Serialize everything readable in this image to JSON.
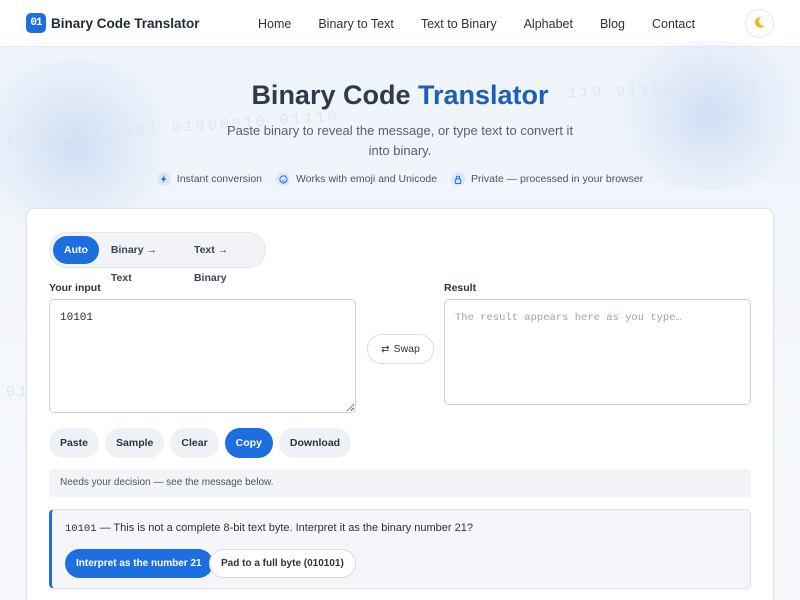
{
  "nav": {
    "logo_mark": "01",
    "logo_text": "Binary Code Translator",
    "links": [
      "Home",
      "Binary to Text",
      "Text to Binary",
      "Alphabet",
      "Blog",
      "Contact"
    ],
    "theme_icon": "moon-icon"
  },
  "hero": {
    "title_part1": "Binary Code",
    "title_part2": "Translator",
    "subtitle": "Paste binary to reveal the message, or type text to convert it into binary.",
    "badges": [
      {
        "icon": "lightning-icon",
        "label": "Instant conversion"
      },
      {
        "icon": "smile-icon",
        "label": "Works with emoji and Unicode"
      },
      {
        "icon": "lock-icon",
        "label": "Private — processed in your browser"
      }
    ],
    "decor_binary": [
      "1000 01101001 01000010 01110",
      "110 01100001 011",
      "01"
    ]
  },
  "translator": {
    "modes": [
      "Auto",
      "Binary → Text",
      "Text → Binary"
    ],
    "active_mode": "Auto",
    "input_label": "Your input",
    "input_value": "10101",
    "result_label": "Result",
    "result_placeholder": "The result appears here as you type…",
    "swap_label": "Swap",
    "actions": [
      "Paste",
      "Sample",
      "Clear",
      "Copy",
      "Download"
    ],
    "status": "Needs your decision — see the message below.",
    "decision": {
      "code": "10101",
      "message": " — This is not a complete 8-bit text byte. Interpret it as the binary number 21?",
      "primary_label": "Interpret as the number 21",
      "secondary_label": "Pad to a full byte (010101)"
    }
  },
  "colors": {
    "accent": "#1d6fe0",
    "title": "#2f3b4c",
    "title_accent": "#1d5fb8"
  }
}
